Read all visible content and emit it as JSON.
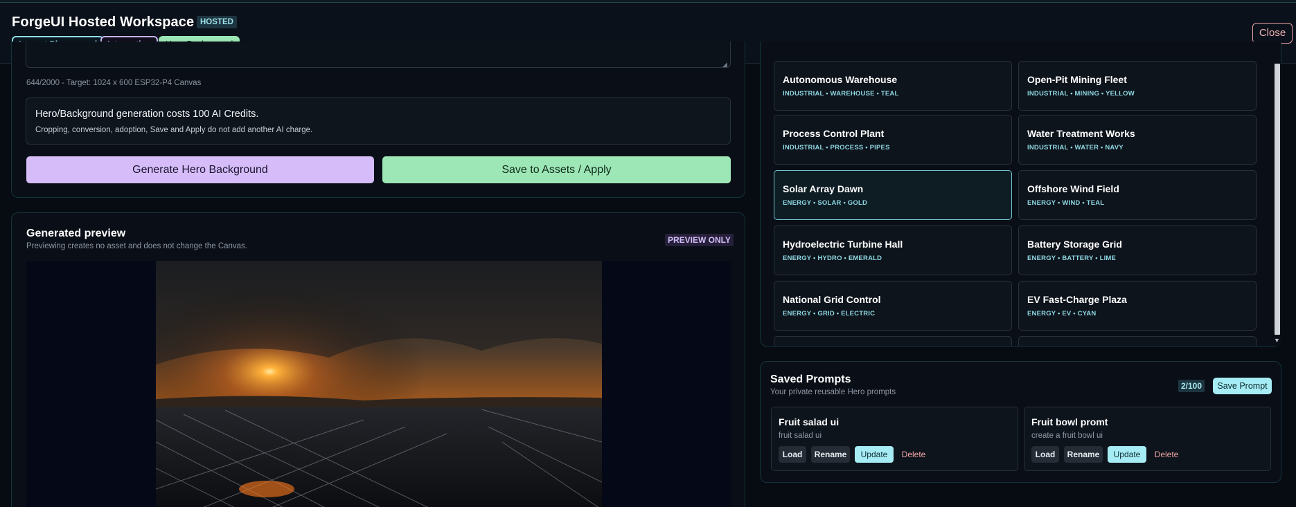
{
  "header": {
    "title": "ForgeUI Hosted Workspace",
    "badge": "HOSTED",
    "chips": [
      "Layout Playground",
      "Interactive",
      "Hero Background"
    ],
    "close_label": "Close"
  },
  "generator": {
    "char_count": "644/2000 - Target: 1024 x 600 ESP32-P4 Canvas",
    "credits_main": "Hero/Background generation costs 100 AI Credits.",
    "credits_sub": "Cropping, conversion, adoption, Save and Apply do not add another AI charge.",
    "generate_label": "Generate Hero Background",
    "save_label": "Save to Assets / Apply"
  },
  "preview": {
    "title": "Generated preview",
    "subtitle": "Previewing creates no asset and does not change the Canvas.",
    "badge": "PREVIEW ONLY"
  },
  "presets": [
    {
      "title": "Autonomous Warehouse",
      "tags": "INDUSTRIAL • WAREHOUSE • TEAL",
      "selected": false
    },
    {
      "title": "Open-Pit Mining Fleet",
      "tags": "INDUSTRIAL • MINING • YELLOW",
      "selected": false
    },
    {
      "title": "Process Control Plant",
      "tags": "INDUSTRIAL • PROCESS • PIPES",
      "selected": false
    },
    {
      "title": "Water Treatment Works",
      "tags": "INDUSTRIAL • WATER • NAVY",
      "selected": false
    },
    {
      "title": "Solar Array Dawn",
      "tags": "ENERGY • SOLAR • GOLD",
      "selected": true
    },
    {
      "title": "Offshore Wind Field",
      "tags": "ENERGY • WIND • TEAL",
      "selected": false
    },
    {
      "title": "Hydroelectric Turbine Hall",
      "tags": "ENERGY • HYDRO • EMERALD",
      "selected": false
    },
    {
      "title": "Battery Storage Grid",
      "tags": "ENERGY • BATTERY • LIME",
      "selected": false
    },
    {
      "title": "National Grid Control",
      "tags": "ENERGY • GRID • ELECTRIC",
      "selected": false
    },
    {
      "title": "EV Fast-Charge Plaza",
      "tags": "ENERGY • EV • CYAN",
      "selected": false
    }
  ],
  "saved": {
    "title": "Saved Prompts",
    "subtitle": "Your private reusable Hero prompts",
    "count": "2/100",
    "save_label": "Save Prompt",
    "prompts": [
      {
        "title": "Fruit salad ui",
        "text": "fruit salad ui"
      },
      {
        "title": "Fruit bowl promt",
        "text": "create a fruit bowl ui"
      }
    ],
    "actions": {
      "load": "Load",
      "rename": "Rename",
      "update": "Update",
      "delete": "Delete"
    }
  },
  "icons": {
    "resize": "resize-grip-icon",
    "scroll_down": "scroll-down-arrow-icon"
  },
  "colors": {
    "accent_teal": "#a6ecf4",
    "accent_purple": "#d6bdf9",
    "accent_green": "#9de7b6",
    "danger": "#f0a7a7",
    "background": "#070b12"
  }
}
